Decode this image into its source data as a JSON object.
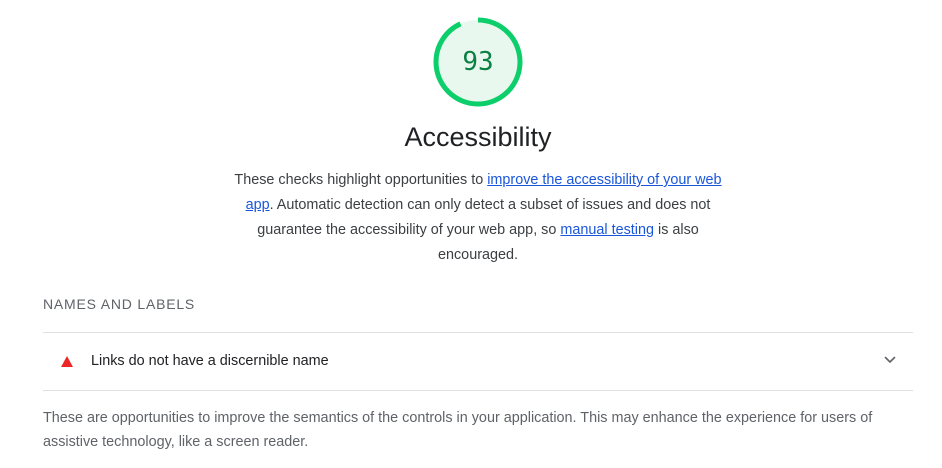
{
  "score": {
    "value": "93",
    "fraction": 0.93,
    "color": "#0cce6b",
    "text_color": "#0b8043",
    "fill_color": "#e8f8ef"
  },
  "category": {
    "title": "Accessibility",
    "description": {
      "part1": "These checks highlight opportunities to ",
      "link1": "improve the accessibility of your web app",
      "part2": ". Automatic detection can only detect a subset of issues and does not guarantee the accessibility of your web app, so ",
      "link2": "manual testing",
      "part3": " is also encouraged."
    }
  },
  "group": {
    "heading": "NAMES AND LABELS",
    "audits": [
      {
        "status_icon": "fail-triangle-icon",
        "status_color": "#eb2727",
        "title": "Links do not have a discernible name",
        "expand_icon": "chevron-down-icon"
      }
    ],
    "description": "These are opportunities to improve the semantics of the controls in your application. This may enhance the experience for users of assistive technology, like a screen reader."
  }
}
